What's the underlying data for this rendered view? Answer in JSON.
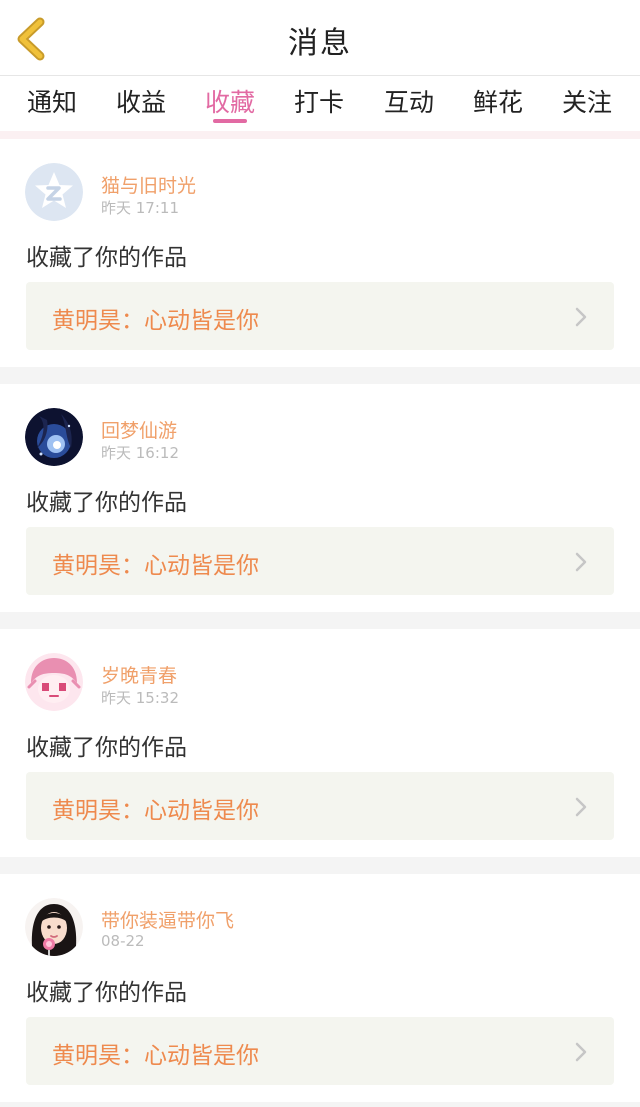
{
  "colors": {
    "accent": "#e26aa3",
    "username": "#f0a06a",
    "work_title": "#ee8a4e",
    "back_icon": "#f0c13a"
  },
  "header": {
    "title": "消息",
    "back_icon": "chevron-left-icon"
  },
  "tabs": [
    {
      "label": "通知",
      "active": false
    },
    {
      "label": "收益",
      "active": false
    },
    {
      "label": "收藏",
      "active": true
    },
    {
      "label": "打卡",
      "active": false
    },
    {
      "label": "互动",
      "active": false
    },
    {
      "label": "鲜花",
      "active": false
    },
    {
      "label": "关注",
      "active": false
    }
  ],
  "messages": [
    {
      "username": "猫与旧时光",
      "time": "昨天 17:11",
      "action": "收藏了你的作品",
      "work_title": "黄明昊：心动皆是你",
      "avatar": "qq-default-avatar"
    },
    {
      "username": "回梦仙游",
      "time": "昨天 16:12",
      "action": "收藏了你的作品",
      "work_title": "黄明昊：心动皆是你",
      "avatar": "anime-night-avatar"
    },
    {
      "username": "岁晚青春",
      "time": "昨天 15:32",
      "action": "收藏了你的作品",
      "work_title": "黄明昊：心动皆是你",
      "avatar": "pink-cartoon-avatar"
    },
    {
      "username": "带你装逼带你飞",
      "time": "08-22",
      "action": "收藏了你的作品",
      "work_title": "黄明昊：心动皆是你",
      "avatar": "girl-lollipop-avatar"
    }
  ]
}
